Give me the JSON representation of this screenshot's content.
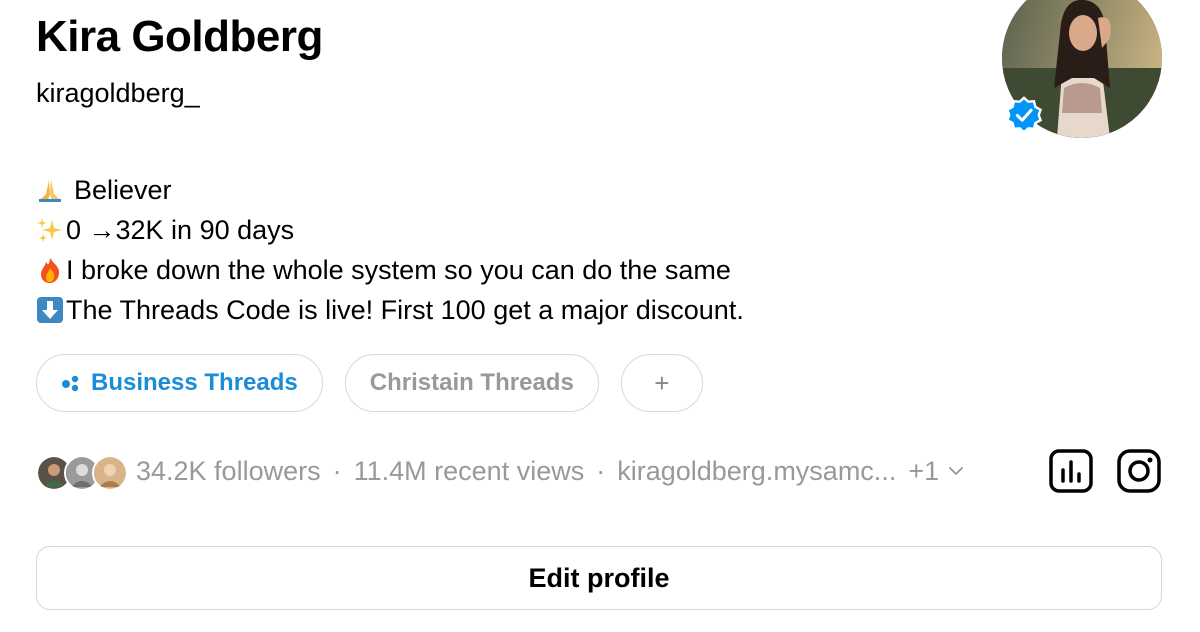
{
  "profile": {
    "display_name": "Kira Goldberg",
    "username": "kiragoldberg_",
    "verified": true
  },
  "bio": [
    {
      "emoji": "folded-hands-emoji",
      "text": "Believer",
      "gap": true
    },
    {
      "emoji": "sparkles-emoji",
      "text": "0 →32K in 90 days",
      "gap": false
    },
    {
      "emoji": "fire-emoji",
      "text": "I broke down the whole system so you can do the same",
      "gap": false
    },
    {
      "emoji": "down-arrow-emoji",
      "text": "The Threads Code is live! First 100 get a major discount.",
      "gap": false
    }
  ],
  "tags": [
    {
      "label": "Business Threads",
      "active": true
    },
    {
      "label": "Christain Threads",
      "active": false
    },
    {
      "label": "+",
      "active": false
    }
  ],
  "stats": {
    "followers": "34.2K followers",
    "separator": "·",
    "views": "11.4M recent views",
    "link": "kiragoldberg.mysamc...",
    "link_more": "+1"
  },
  "actions": {
    "insights_icon": "insights-icon",
    "instagram_icon": "instagram-icon"
  },
  "edit_button": {
    "label": "Edit profile"
  },
  "colors": {
    "accent": "#1a8cd8",
    "muted": "#999999",
    "border": "#d9d9d9",
    "verified": "#0095f6"
  }
}
